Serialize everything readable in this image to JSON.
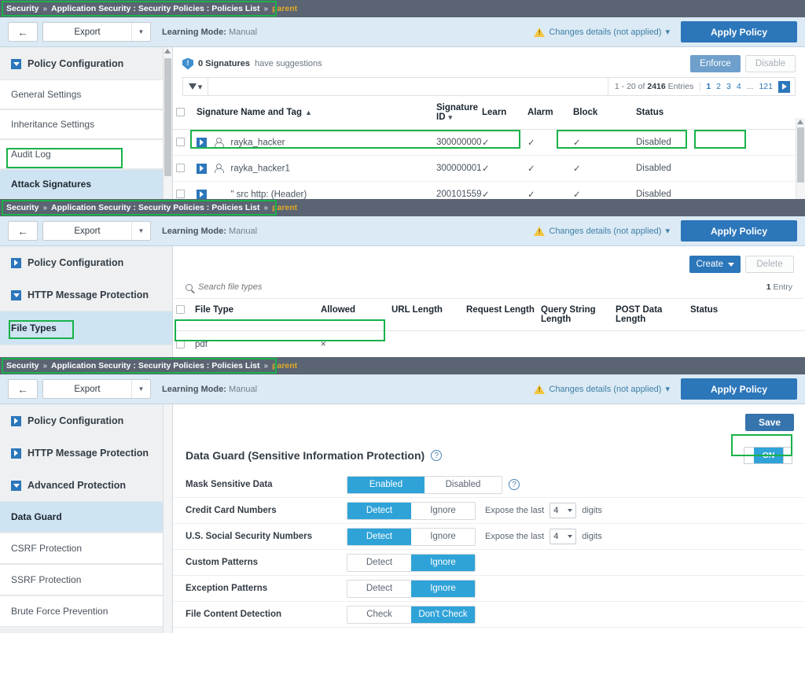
{
  "breadcrumb": {
    "part1": "Security",
    "sep": "»",
    "part2": "Application Security : Security Policies : Policies List",
    "part3": "parent"
  },
  "toolbar": {
    "back_icon": "arrow-left-icon",
    "export_label": "Export",
    "learning_label": "Learning Mode:",
    "learning_value": "Manual",
    "changes_label": "Changes details (not applied)",
    "changes_caret": "▾",
    "apply_label": "Apply Policy"
  },
  "panel1": {
    "sidebar": {
      "group_label": "Policy Configuration",
      "items": [
        {
          "label": "General Settings",
          "active": false
        },
        {
          "label": "Inheritance Settings",
          "active": false
        },
        {
          "label": "Audit Log",
          "active": false
        },
        {
          "label": "Attack Signatures",
          "active": true
        }
      ]
    },
    "suggestion_count": "0 Signatures",
    "suggestion_text": "have suggestions",
    "enforce_label": "Enforce",
    "disable_label": "Disable",
    "entries_prefix": "1 - 20 of",
    "entries_count": "2416",
    "entries_suffix": "Entries",
    "pages": [
      "1",
      "2",
      "3",
      "4",
      "...",
      "121"
    ],
    "columns": [
      "Signature Name and Tag",
      "Signature ID",
      "Learn",
      "Alarm",
      "Block",
      "Status"
    ],
    "rows": [
      {
        "name": "rayka_hacker",
        "icon": "user-icon",
        "id": "300000000",
        "learn": "✓",
        "alarm": "✓",
        "block": "✓",
        "status": "Disabled"
      },
      {
        "name": "rayka_hacker1",
        "icon": "user-icon",
        "id": "300000001",
        "learn": "✓",
        "alarm": "✓",
        "block": "✓",
        "status": "Disabled"
      },
      {
        "name": "\" src http: (Header)",
        "icon": "none",
        "id": "200101559",
        "learn": "✓",
        "alarm": "✓",
        "block": "✓",
        "status": "Disabled"
      }
    ]
  },
  "panel2": {
    "sidebar": {
      "group1_label": "Policy Configuration",
      "group2_label": "HTTP Message Protection",
      "items": [
        {
          "label": "File Types",
          "active": true
        }
      ]
    },
    "create_label": "Create",
    "delete_label": "Delete",
    "search_placeholder": "Search file types",
    "entry_count": "1",
    "entry_suffix": "Entry",
    "columns": [
      "File Type",
      "Allowed",
      "URL Length",
      "Request Length",
      "Query String Length",
      "POST Data Length",
      "Status"
    ],
    "rows": [
      {
        "file_type": "pdf",
        "allowed": "×",
        "url_length": "",
        "request_length": "",
        "query_string_length": "",
        "post_data_length": "",
        "status": ""
      }
    ]
  },
  "panel3": {
    "sidebar": {
      "group1_label": "Policy Configuration",
      "group2_label": "HTTP Message Protection",
      "group3_label": "Advanced Protection",
      "items": [
        {
          "label": "Data Guard",
          "active": true
        },
        {
          "label": "CSRF Protection",
          "active": false
        },
        {
          "label": "SSRF Protection",
          "active": false
        },
        {
          "label": "Brute Force Prevention",
          "active": false
        }
      ]
    },
    "save_label": "Save",
    "section_title": "Data Guard (Sensitive Information Protection)",
    "help_glyph": "?",
    "toggle_state": "ON",
    "settings": [
      {
        "label": "Mask Sensitive Data",
        "opt_a": "Enabled",
        "opt_b": "Disabled",
        "selected": "a",
        "wide": true,
        "help": true,
        "expose": false
      },
      {
        "label": "Credit Card Numbers",
        "opt_a": "Detect",
        "opt_b": "Ignore",
        "selected": "a",
        "wide": false,
        "help": false,
        "expose": true,
        "expose_label": "Expose the last",
        "expose_value": "4",
        "expose_suffix": "digits"
      },
      {
        "label": "U.S. Social Security Numbers",
        "opt_a": "Detect",
        "opt_b": "Ignore",
        "selected": "a",
        "wide": false,
        "help": false,
        "expose": true,
        "expose_label": "Expose the last",
        "expose_value": "4",
        "expose_suffix": "digits"
      },
      {
        "label": "Custom Patterns",
        "opt_a": "Detect",
        "opt_b": "Ignore",
        "selected": "b",
        "wide": false,
        "help": false,
        "expose": false
      },
      {
        "label": "Exception Patterns",
        "opt_a": "Detect",
        "opt_b": "Ignore",
        "selected": "b",
        "wide": false,
        "help": false,
        "expose": false
      },
      {
        "label": "File Content Detection",
        "opt_a": "Check",
        "opt_b": "Don't Check",
        "selected": "b",
        "wide": false,
        "help": false,
        "expose": false
      }
    ]
  },
  "colors": {
    "highlight": "#19b24a",
    "breadcrumb_bg": "#5a6472",
    "breadcrumb_accent": "#e0a92b",
    "primary": "#2c76ba",
    "toggle_on": "#2fa3d8"
  }
}
